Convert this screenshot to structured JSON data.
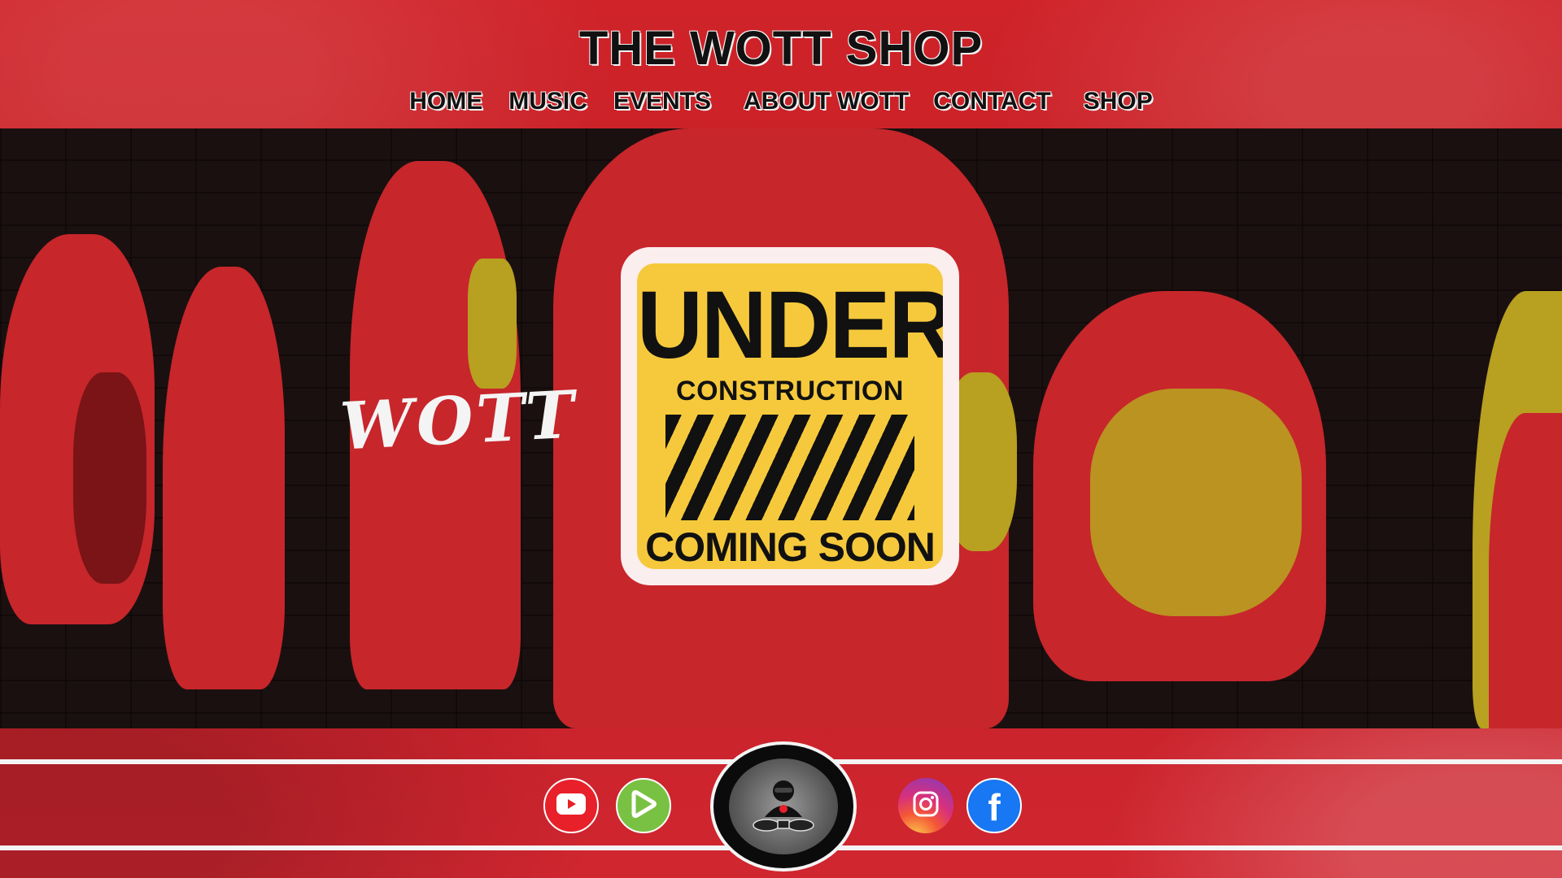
{
  "header": {
    "title": "THE WOTT SHOP",
    "nav": [
      {
        "label": "HOME"
      },
      {
        "label": "MUSIC"
      },
      {
        "label": "EVENTS"
      },
      {
        "label": "ABOUT WOTT"
      },
      {
        "label": "CONTACT"
      },
      {
        "label": "SHOP"
      }
    ]
  },
  "hero": {
    "script_text": "WOTT",
    "sign": {
      "line1": "UNDER",
      "line2": "CONSTRUCTION",
      "line3": "COMING SOON"
    }
  },
  "footer": {
    "social": [
      {
        "icon": "youtube-icon"
      },
      {
        "icon": "rumble-icon"
      },
      {
        "icon": "instagram-icon"
      },
      {
        "icon": "facebook-icon"
      }
    ],
    "facebook_glyph": "f",
    "logo": {
      "icon": "dj-logo-icon"
    }
  },
  "colors": {
    "page_red": "#c8202a",
    "sign_yellow": "#f6c93c",
    "sign_border": "#fbeeee",
    "youtube_red": "#e8202a",
    "rumble_green": "#79c142",
    "facebook_blue": "#1877f2"
  }
}
